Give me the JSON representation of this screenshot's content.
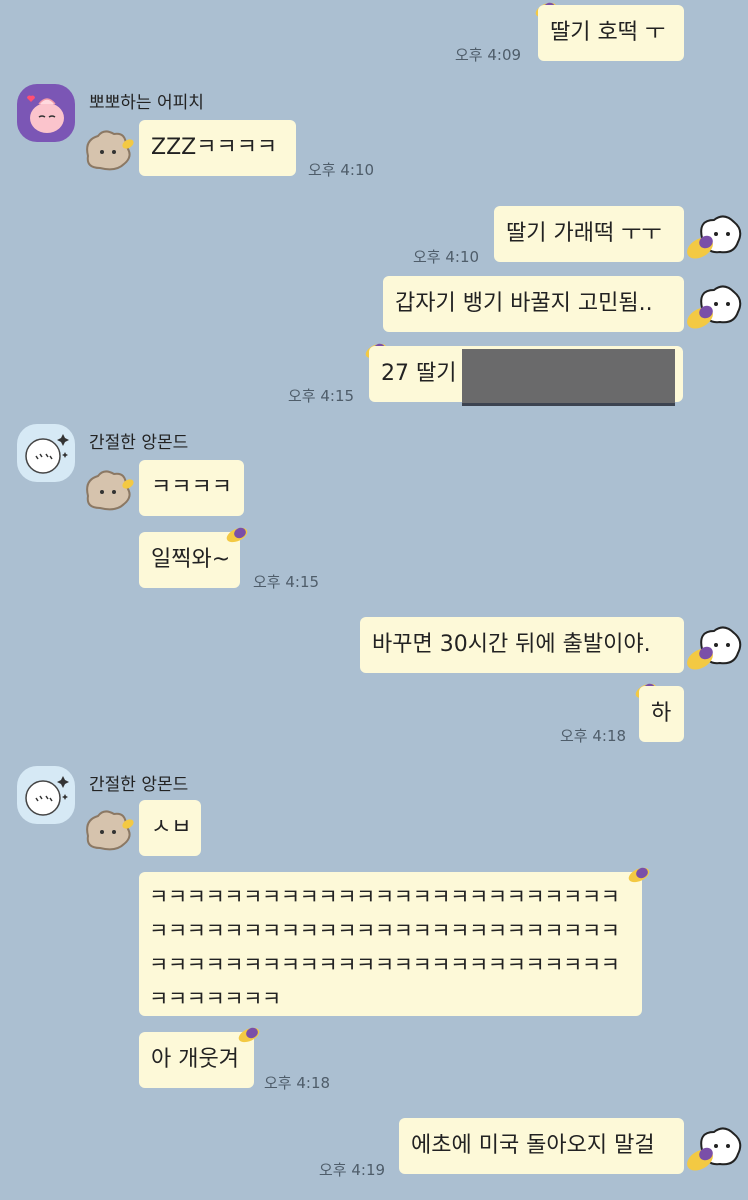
{
  "chat": {
    "messages": [
      {
        "text": "딸기 호떡 ㅜ",
        "time": "오후 4:09"
      },
      {
        "sender": "뽀뽀하는 어피치",
        "text": "ZZZㅋㅋㅋㅋ",
        "time": "오후 4:10"
      },
      {
        "text": "딸기 가래떡 ㅜㅜ",
        "time": "오후 4:10"
      },
      {
        "text": "갑자기 뱅기 바꿀지 고민됨.."
      },
      {
        "text": "27 딸기",
        "time": "오후 4:15"
      },
      {
        "sender": "간절한 앙몬드",
        "text": "ㅋㅋㅋㅋ"
      },
      {
        "text": "일찍와~",
        "time": "오후 4:15"
      },
      {
        "text": "바꾸면 30시간 뒤에 출발이야."
      },
      {
        "text": "하",
        "time": "오후 4:18"
      },
      {
        "sender": "간절한 앙몬드",
        "text": "ㅅㅂ"
      },
      {
        "text": "ㅋㅋㅋㅋㅋㅋㅋㅋㅋㅋㅋㅋㅋㅋㅋㅋㅋㅋㅋㅋㅋㅋㅋㅋㅋㅋㅋㅋㅋㅋㅋㅋㅋㅋㅋㅋㅋㅋㅋㅋㅋㅋㅋㅋㅋㅋㅋㅋㅋㅋㅋㅋㅋㅋㅋㅋㅋㅋㅋㅋㅋㅋㅋㅋㅋㅋㅋㅋㅋㅋㅋㅋㅋㅋㅋㅋㅋㅋㅋㅋㅋㅋ"
      },
      {
        "text": "아 개웃겨",
        "time": "오후 4:18"
      },
      {
        "text": "에초에 미국 돌아오지 말걸",
        "time": "오후 4:19"
      }
    ]
  },
  "colors": {
    "background": "#abbfd1",
    "bubble": "#fdf9d8",
    "time_text": "#4f5d6a"
  },
  "icons": {
    "sweet_potato": "sweet-potato-icon",
    "mascot_right": "white-blob-mascot-icon",
    "mascot_left": "beige-blob-mascot-icon"
  }
}
